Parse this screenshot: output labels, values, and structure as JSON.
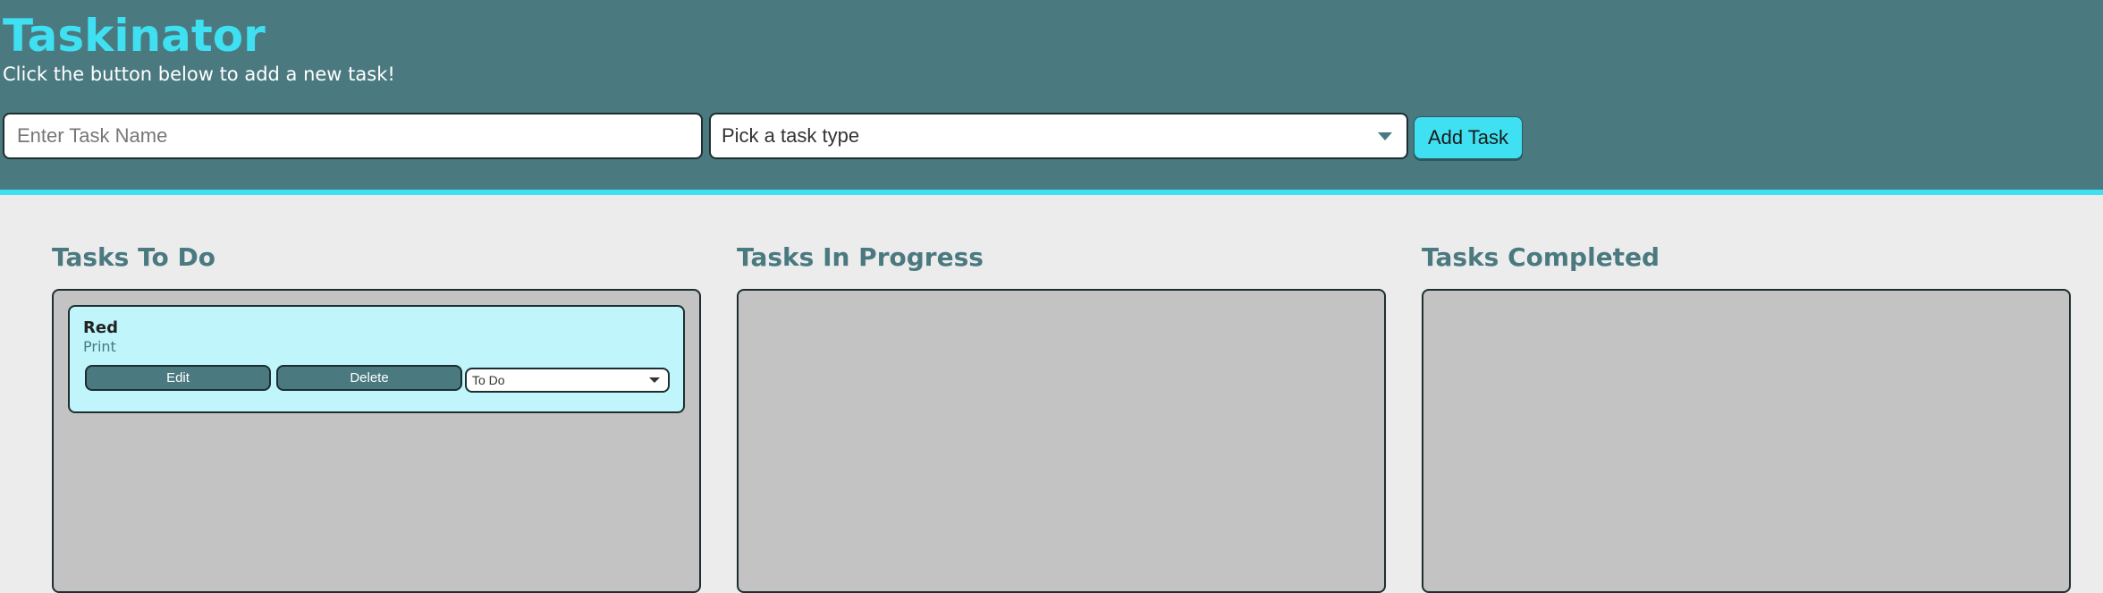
{
  "header": {
    "title": "Taskinator",
    "subtitle": "Click the button below to add a new task!"
  },
  "form": {
    "task_name_placeholder": "Enter Task Name",
    "task_name_value": "",
    "task_type_selected": "Pick a task type",
    "add_button_label": "Add Task"
  },
  "columns": [
    {
      "title": "Tasks To Do",
      "tasks": [
        {
          "name": "Red",
          "type": "Print",
          "edit_label": "Edit",
          "delete_label": "Delete",
          "status_selected": "To Do"
        }
      ]
    },
    {
      "title": "Tasks In Progress",
      "tasks": []
    },
    {
      "title": "Tasks Completed",
      "tasks": []
    }
  ],
  "colors": {
    "header_bg": "#4a7a80",
    "accent": "#3fe0f2",
    "page_bg": "#ececec",
    "list_bg": "#c3c3c3",
    "card_bg": "#bff5fb"
  },
  "icons": {
    "select_caret": "chevron-down-icon"
  }
}
